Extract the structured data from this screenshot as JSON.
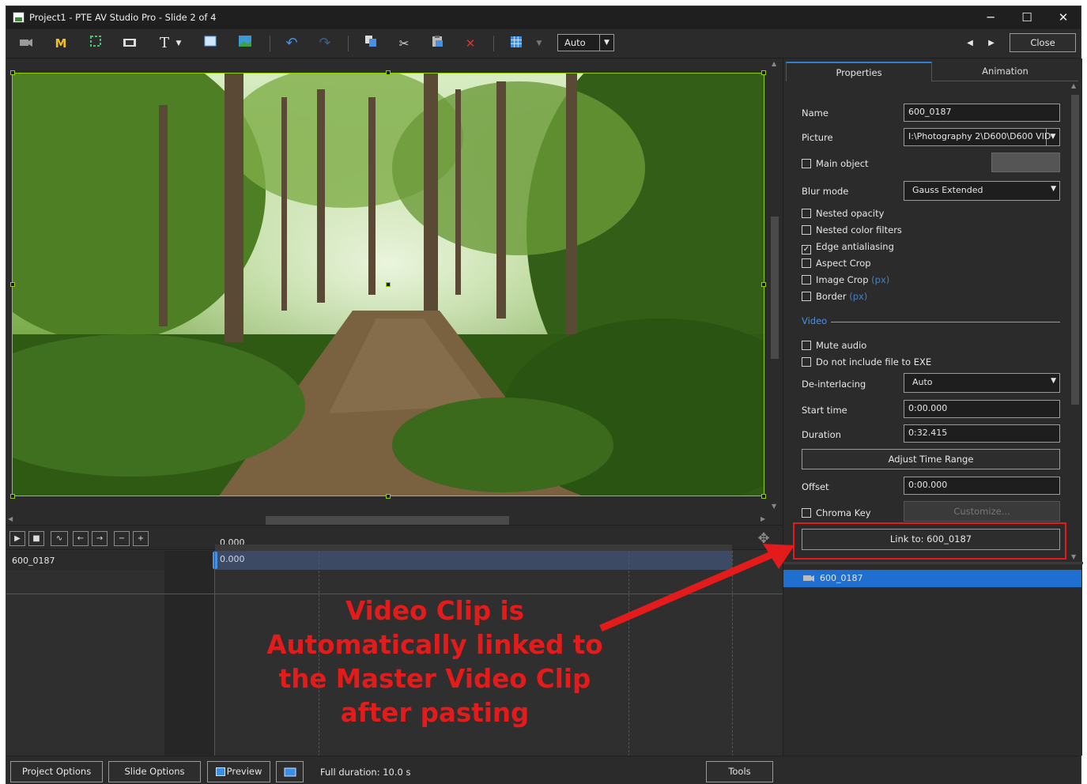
{
  "window": {
    "title": "Project1 - PTE AV Studio Pro - Slide 2 of 4",
    "minimize": "─",
    "maximize": "☐",
    "close": "✕"
  },
  "toolbar": {
    "m_label": "M",
    "t_label": "T",
    "combo_value": "Auto",
    "close_label": "Close"
  },
  "icons": [
    "video-object-icon",
    "mask-icon",
    "frame-icon",
    "counter-icon",
    "text-icon",
    "rectangle-icon",
    "image-icon",
    "undo-icon",
    "redo-icon",
    "copy-icon",
    "cut-icon",
    "paste-icon",
    "delete-icon",
    "grid-icon",
    "prev-arrow-icon",
    "next-arrow-icon"
  ],
  "properties": {
    "tabs": [
      "Properties",
      "Animation"
    ],
    "name_label": "Name",
    "name_value": "600_0187",
    "picture_label": "Picture",
    "picture_value": "I:\\Photography 2\\D600\\D600 VID",
    "main_object": "Main object",
    "blur_label": "Blur mode",
    "blur_value": "Gauss Extended",
    "nested_opacity": "Nested opacity",
    "nested_color": "Nested color filters",
    "edge_aa": "Edge antialiasing",
    "aspect_crop": "Aspect Crop",
    "image_crop": "Image Crop",
    "px": "(px)",
    "border": "Border",
    "video_section": "Video",
    "mute_audio": "Mute audio",
    "no_exe": "Do not include file to EXE",
    "deint_label": "De-interlacing",
    "deint_value": "Auto",
    "start_label": "Start time",
    "start_value": "0:00.000",
    "duration_label": "Duration",
    "duration_value": "0:32.415",
    "adjust_btn": "Adjust Time Range",
    "offset_label": "Offset",
    "offset_value": "0:00.000",
    "chroma_key": "Chroma Key",
    "customize_btn": "Customize...",
    "link_btn": "Link to: 600_0187"
  },
  "objects_list": [
    {
      "label": "600_0187",
      "selected": true
    }
  ],
  "timeline": {
    "time_top": "0.000",
    "time_track": "0.000",
    "track_name": "600_0187"
  },
  "status": {
    "project_options": "Project Options",
    "slide_options": "Slide Options",
    "preview": "Preview",
    "full_duration": "Full duration: 10.0 s",
    "tools": "Tools"
  },
  "annotation": {
    "line1": "Video Clip is",
    "line2": "Automatically linked to",
    "line3": "the Master Video Clip",
    "line4": "after pasting"
  },
  "colors": {
    "accent": "#2f7fd0",
    "highlight": "#e31b1b",
    "selection": "#1e6fcf",
    "frame": "#8fd000"
  }
}
